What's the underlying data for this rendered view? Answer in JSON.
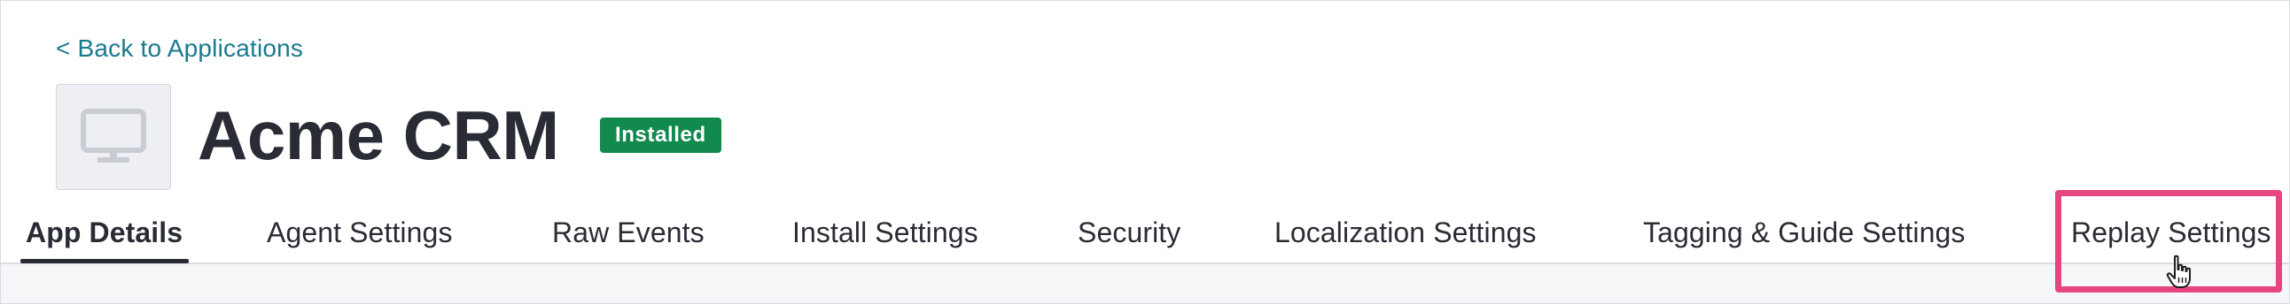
{
  "header": {
    "back_link": "< Back to Applications",
    "app_title": "Acme CRM",
    "status_badge": "Installed",
    "app_icon": "monitor-icon"
  },
  "tabs": [
    {
      "label": "App Details",
      "active": true
    },
    {
      "label": "Agent Settings",
      "active": false
    },
    {
      "label": "Raw Events",
      "active": false
    },
    {
      "label": "Install Settings",
      "active": false
    },
    {
      "label": "Security",
      "active": false
    },
    {
      "label": "Localization Settings",
      "active": false
    },
    {
      "label": "Tagging & Guide Settings",
      "active": false
    },
    {
      "label": "Replay Settings",
      "active": false
    }
  ],
  "colors": {
    "link": "#1a7a8f",
    "badge": "#128a4e",
    "highlight": "#e6457f",
    "text": "#2a2c35"
  }
}
